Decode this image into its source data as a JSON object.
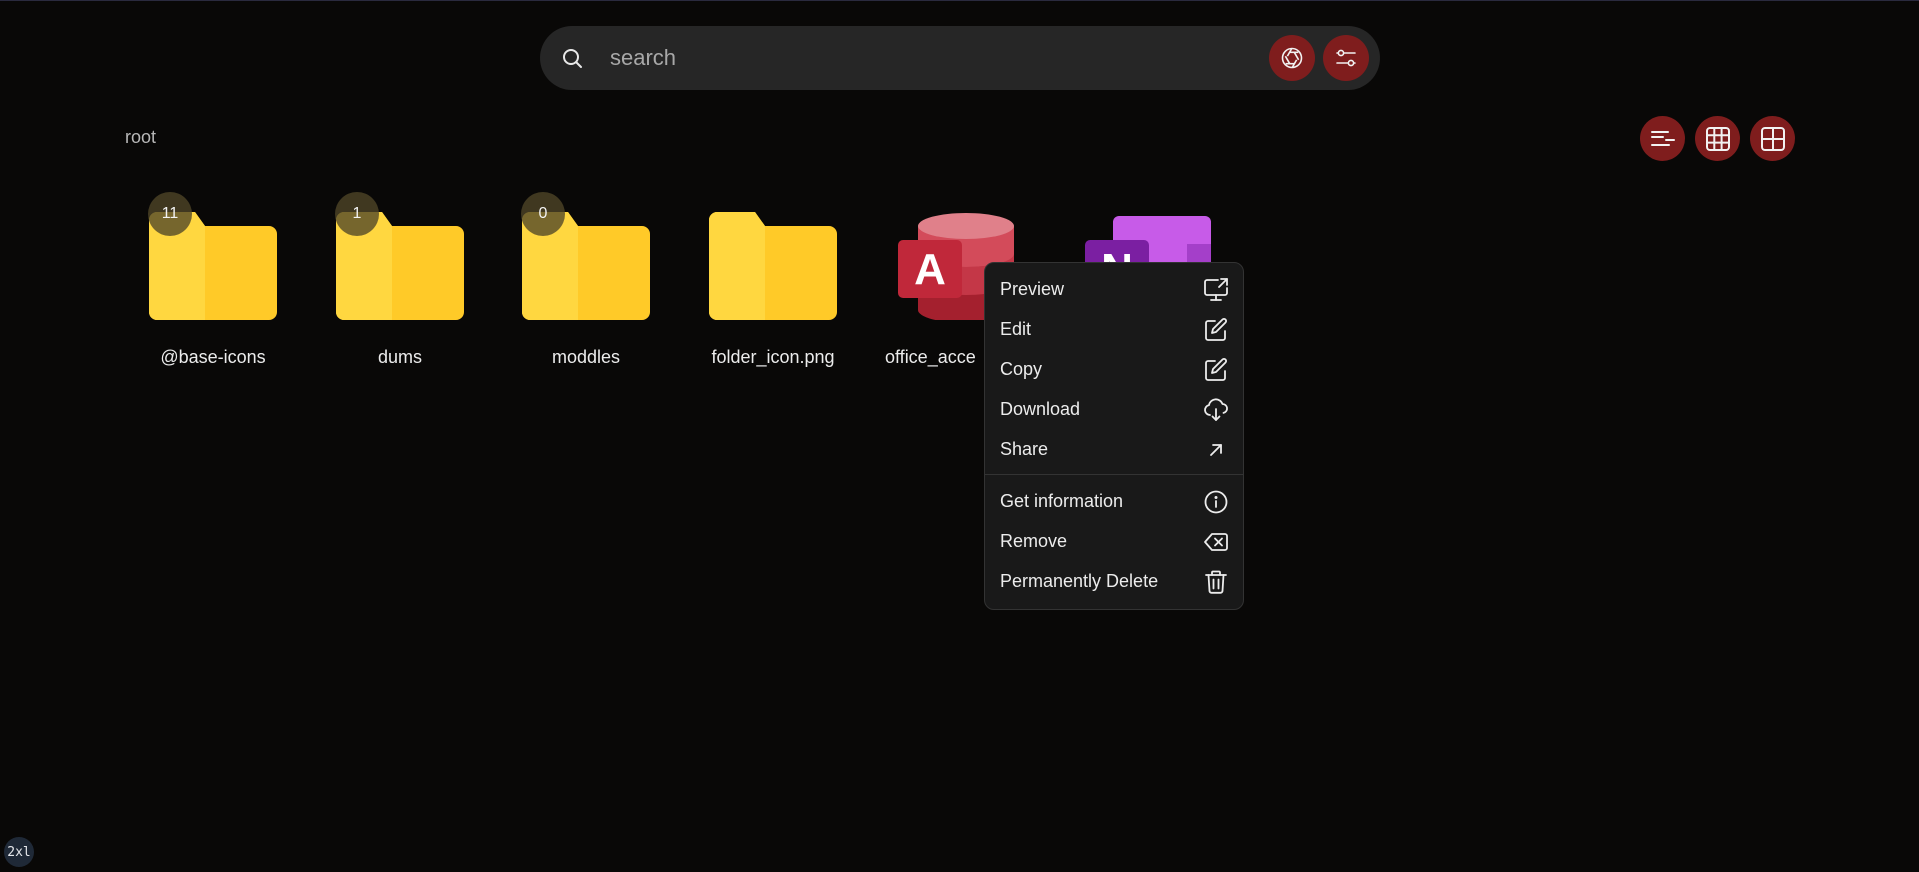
{
  "search": {
    "placeholder": "search"
  },
  "breadcrumb": {
    "path": "root"
  },
  "view_buttons": [
    "list-view-icon",
    "grid-view-icon",
    "large-grid-view-icon"
  ],
  "toolbar_icons": [
    "camera-aperture-icon",
    "filter-sliders-icon"
  ],
  "files": [
    {
      "name": "@base-icons",
      "type": "folder",
      "count": "11"
    },
    {
      "name": "dums",
      "type": "folder",
      "count": "1"
    },
    {
      "name": "moddles",
      "type": "folder",
      "count": "0"
    },
    {
      "name": "folder_icon.png",
      "type": "folder-image",
      "count": ""
    },
    {
      "name": "office_acce",
      "type": "access-app"
    },
    {
      "name": "",
      "type": "onenote-app"
    }
  ],
  "context_menu": {
    "items": [
      {
        "label": "Preview",
        "icon": "preview-monitor-icon"
      },
      {
        "label": "Edit",
        "icon": "edit-pencil-icon"
      },
      {
        "label": "Copy",
        "icon": "copy-pencil-icon"
      },
      {
        "label": "Download",
        "icon": "cloud-download-icon"
      },
      {
        "label": "Share",
        "icon": "share-arrow-icon"
      },
      {
        "label": "Get information",
        "icon": "info-circle-icon"
      },
      {
        "label": "Remove",
        "icon": "backspace-remove-icon"
      },
      {
        "label": "Permanently Delete",
        "icon": "trash-icon"
      }
    ]
  },
  "breakpoint_badge": "2xl",
  "colors": {
    "background": "#090807",
    "accent": "#7f1d1d",
    "folder_front": "#ffd53d",
    "folder_back": "#ffa000",
    "access": "#c0283a",
    "onenote": "#b44fe0"
  }
}
